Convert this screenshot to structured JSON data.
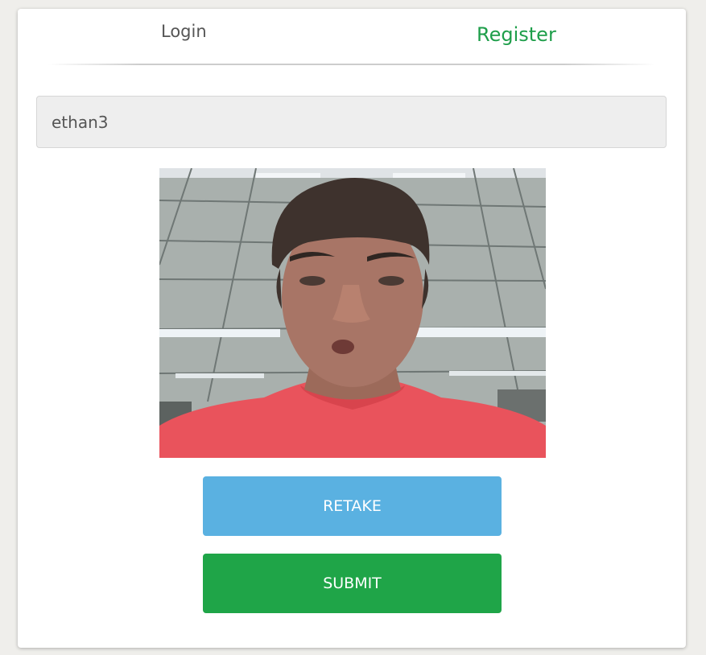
{
  "tabs": {
    "login_label": "Login",
    "register_label": "Register",
    "active": "register"
  },
  "form": {
    "username_value": "ethan3"
  },
  "buttons": {
    "retake_label": "RETAKE",
    "submit_label": "SUBMIT"
  },
  "colors": {
    "accent_green": "#1e9e4a",
    "retake_blue": "#5ab1e1",
    "submit_green": "#1fa548"
  }
}
